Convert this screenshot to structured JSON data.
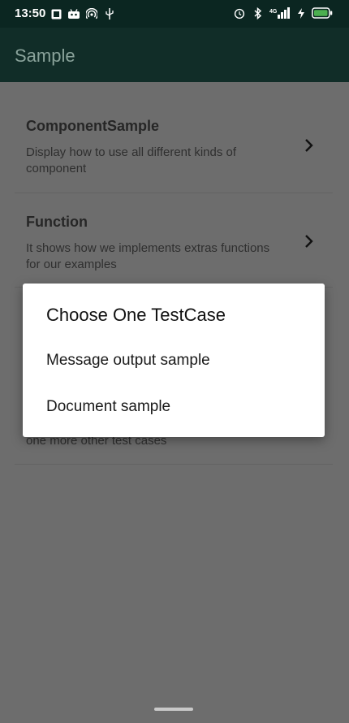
{
  "status_bar": {
    "time": "13:50",
    "left_icons": [
      "sim-card-icon",
      "android-icon",
      "hotspot-icon",
      "usb-icon"
    ],
    "right_icons": [
      "alarm-icon",
      "bluetooth-icon",
      "signal-icon",
      "charging-icon",
      "battery-icon"
    ],
    "network": "4G"
  },
  "app_bar": {
    "title": "Sample",
    "color": "#112d28"
  },
  "list": {
    "items": [
      {
        "title": "ComponentSample",
        "description": "Display how to use all different kinds of component"
      },
      {
        "title": "Function",
        "description": "It shows how we implements extras functions for our examples"
      },
      {
        "title": "",
        "description": "one more other test cases"
      }
    ]
  },
  "dialog": {
    "title": "Choose One TestCase",
    "options": [
      "Message output sample",
      "Document sample"
    ]
  }
}
